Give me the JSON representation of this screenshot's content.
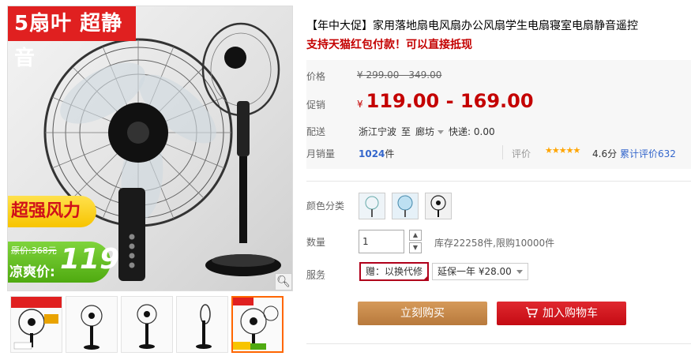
{
  "gallery": {
    "badge_blades": "5扇叶  超静音",
    "badge_power": "超强风力",
    "badge_orig_price": "原价:368元",
    "badge_cool_price_label": "凉爽价:",
    "badge_cool_price": "119",
    "zoom_icon": "magnifier-icon",
    "thumbnails": [
      {
        "label": "thumb-1"
      },
      {
        "label": "thumb-2"
      },
      {
        "label": "thumb-3"
      },
      {
        "label": "thumb-4"
      },
      {
        "label": "thumb-5",
        "active": true
      }
    ]
  },
  "product": {
    "title": "【年中大促】家用落地扇电风扇办公风扇学生电扇寝室电扇静音遥控",
    "subtitle": "支持天猫红包付款！可以直接抵现",
    "price_label": "价格",
    "price_value": "¥ 299.00 - 349.00",
    "promo_label": "促销",
    "promo_currency": "¥",
    "promo_value": "119.00 - 169.00",
    "ship_label": "配送",
    "ship_from": "浙江宁波",
    "ship_to_word": "至",
    "ship_to": "廊坊",
    "ship_fee": "快递: 0.00",
    "sales_label": "月销量",
    "sales_count": "1024",
    "sales_unit": "件",
    "rating_label": "评价",
    "rating_stars": "★★★★★",
    "rating_score": "4.6分",
    "rating_total": "累计评价632",
    "color_label": "颜色分类",
    "quantity_label": "数量",
    "quantity_value": "1",
    "stock_text": "库存22258件,限购10000件",
    "service_label": "服务",
    "service_gift": "赠：以换代修",
    "service_warranty": "延保一年 ¥28.00",
    "buy_now": "立刻购买",
    "add_to_cart": "加入购物车"
  },
  "colors": {
    "accent_red": "#c40000",
    "buy_button": "#c98a4b",
    "cart_button": "#d0161d",
    "link_blue": "#3366cc"
  }
}
